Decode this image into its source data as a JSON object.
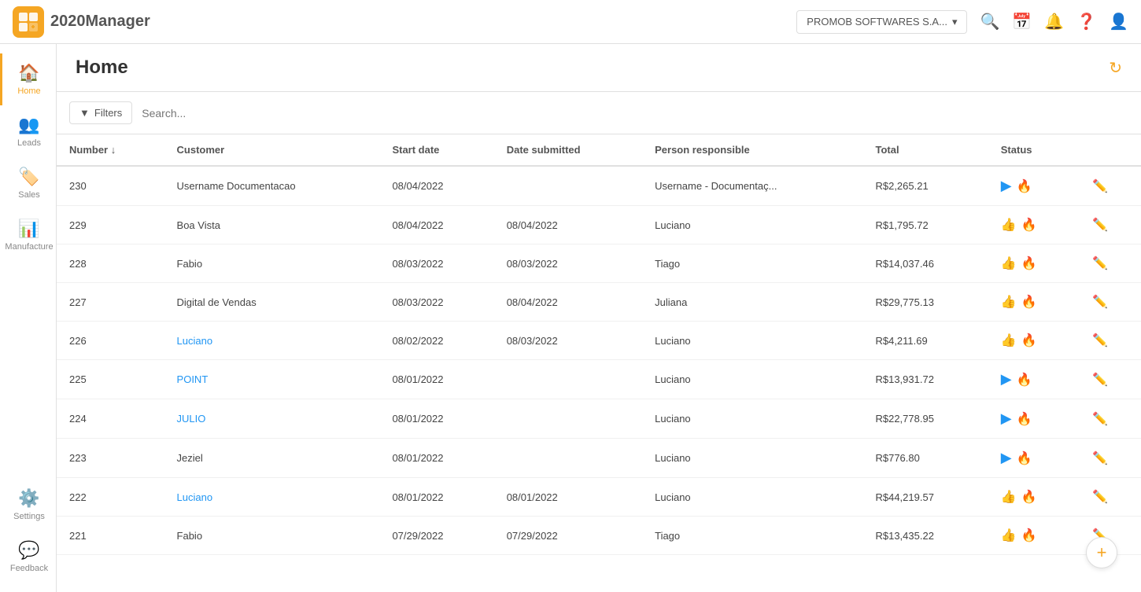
{
  "topbar": {
    "logo_text": "2020",
    "logo_sub": "Manager",
    "company": "PROMOB SOFTWARES S.A...",
    "icons": [
      "search",
      "calendar",
      "bell",
      "help",
      "user"
    ]
  },
  "sidebar": {
    "items": [
      {
        "label": "Home",
        "icon": "🏠",
        "active": true
      },
      {
        "label": "Leads",
        "icon": "👥",
        "active": false
      },
      {
        "label": "Sales",
        "icon": "🏷️",
        "active": false
      },
      {
        "label": "Manufacture",
        "icon": "📊",
        "active": false
      },
      {
        "label": "Settings",
        "icon": "⚙️",
        "active": false
      },
      {
        "label": "Feedback",
        "icon": "💬",
        "active": false
      }
    ]
  },
  "main": {
    "title": "Home",
    "filters": {
      "button_label": "Filters",
      "search_placeholder": "Search..."
    },
    "table": {
      "columns": [
        "Number",
        "Customer",
        "Start date",
        "Date submitted",
        "Person responsible",
        "Total",
        "Status"
      ],
      "rows": [
        {
          "number": "230",
          "customer": "Username Documentacao",
          "start_date": "08/04/2022",
          "date_submitted": "",
          "person": "Username - Documentaç...",
          "total": "R$2,265.21",
          "status": "play-fire",
          "link": false
        },
        {
          "number": "229",
          "customer": "Boa Vista",
          "start_date": "08/04/2022",
          "date_submitted": "08/04/2022",
          "person": "Luciano",
          "total": "R$1,795.72",
          "status": "thumb-fire",
          "link": false
        },
        {
          "number": "228",
          "customer": "Fabio",
          "start_date": "08/03/2022",
          "date_submitted": "08/03/2022",
          "person": "Tiago",
          "total": "R$14,037.46",
          "status": "thumb-fire",
          "link": false
        },
        {
          "number": "227",
          "customer": "Digital de Vendas",
          "start_date": "08/03/2022",
          "date_submitted": "08/04/2022",
          "person": "Juliana",
          "total": "R$29,775.13",
          "status": "thumb-fire",
          "link": false
        },
        {
          "number": "226",
          "customer": "Luciano",
          "start_date": "08/02/2022",
          "date_submitted": "08/03/2022",
          "person": "Luciano",
          "total": "R$4,211.69",
          "status": "thumb-fire",
          "link": true
        },
        {
          "number": "225",
          "customer": "POINT",
          "start_date": "08/01/2022",
          "date_submitted": "",
          "person": "Luciano",
          "total": "R$13,931.72",
          "status": "play-fire",
          "link": true
        },
        {
          "number": "224",
          "customer": "JULIO",
          "start_date": "08/01/2022",
          "date_submitted": "",
          "person": "Luciano",
          "total": "R$22,778.95",
          "status": "play-fire",
          "link": true
        },
        {
          "number": "223",
          "customer": "Jeziel",
          "start_date": "08/01/2022",
          "date_submitted": "",
          "person": "Luciano",
          "total": "R$776.80",
          "status": "play-fire",
          "link": false
        },
        {
          "number": "222",
          "customer": "Luciano",
          "start_date": "08/01/2022",
          "date_submitted": "08/01/2022",
          "person": "Luciano",
          "total": "R$44,219.57",
          "status": "thumb-fire",
          "link": true
        },
        {
          "number": "221",
          "customer": "Fabio",
          "start_date": "07/29/2022",
          "date_submitted": "07/29/2022",
          "person": "Tiago",
          "total": "R$13,435.22",
          "status": "thumb-fire",
          "link": false
        }
      ]
    }
  }
}
